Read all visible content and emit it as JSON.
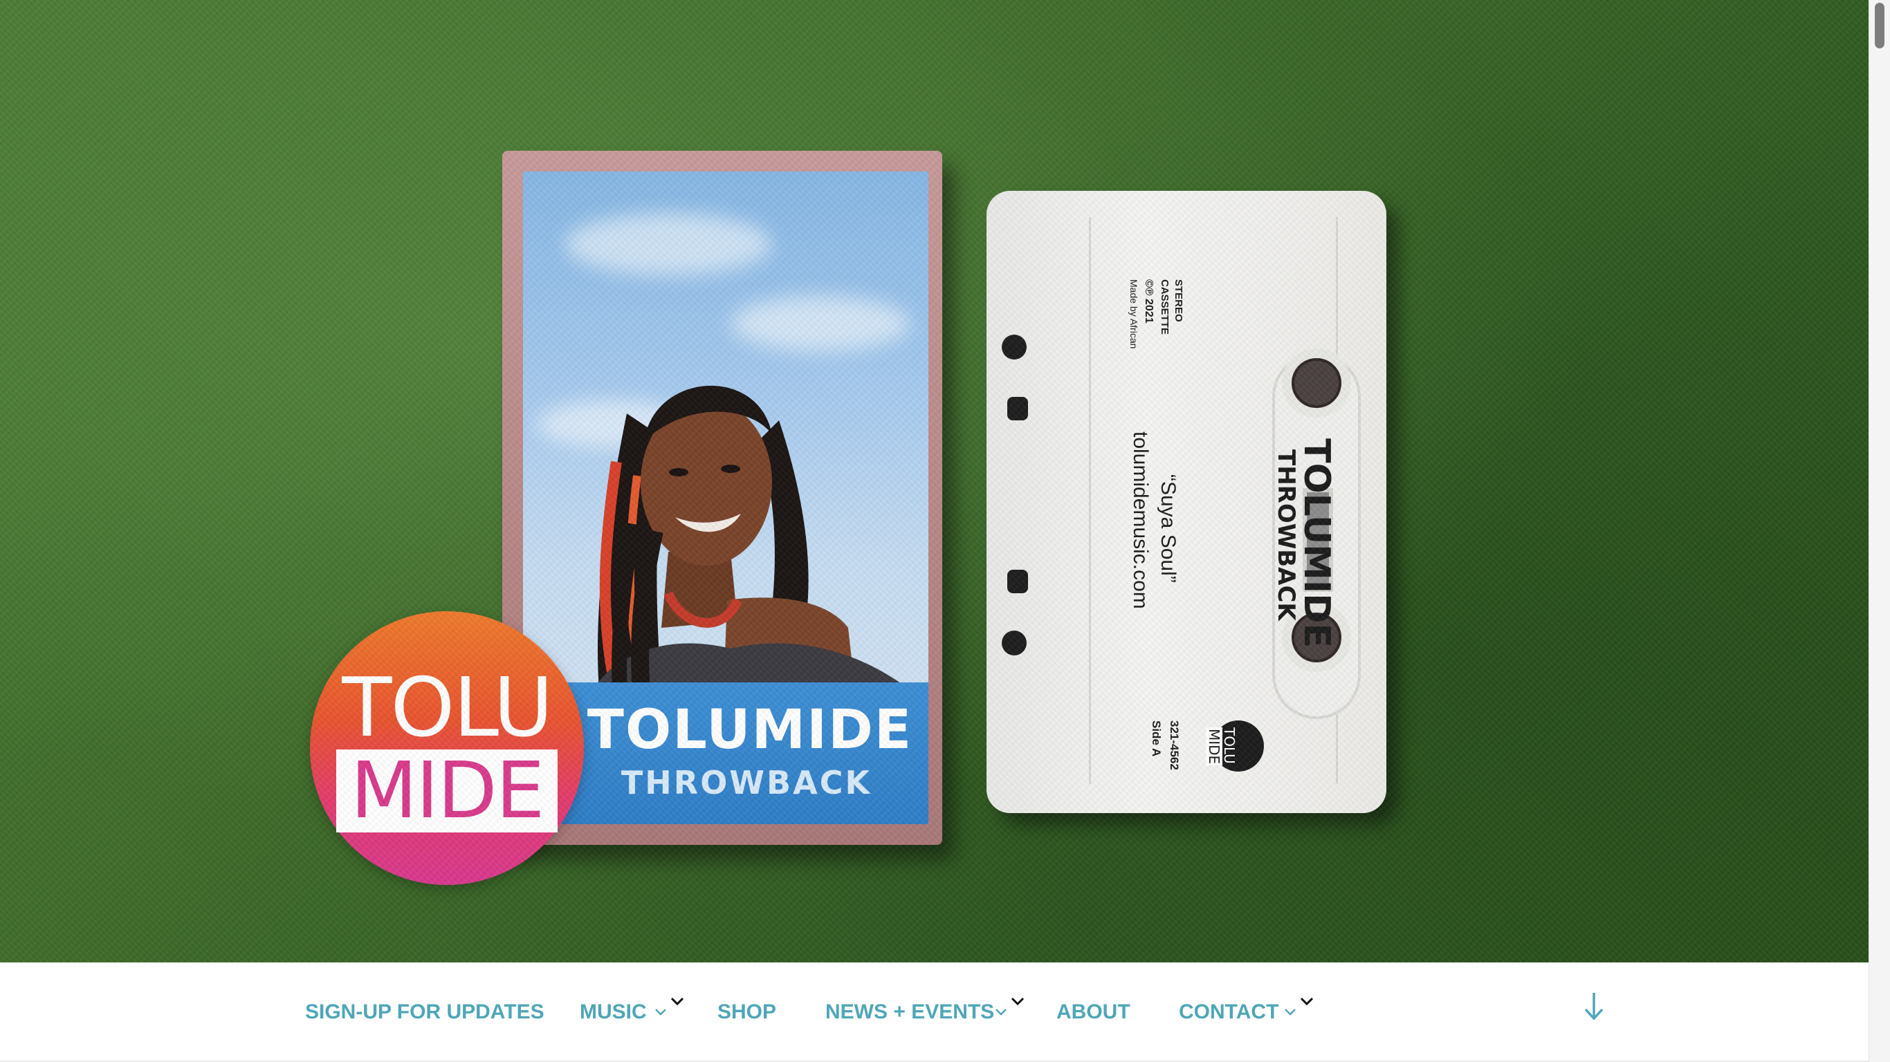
{
  "hero": {
    "case": {
      "title": "TOLUMIDE",
      "subtitle": "THROWBACK"
    },
    "tape": {
      "brand_title": "TOLUMIDE",
      "brand_subtitle": "THROWBACK",
      "song": "“Suya Soul”",
      "website": "tolumidemusic.com",
      "stereo_line1": "STEREO",
      "stereo_line2": "CASSETTE",
      "copyright": "©℗ 2021",
      "made_by": "Made by African",
      "catalog": "321-4562",
      "side": "Side A",
      "mini_logo_top": "TOLU",
      "mini_logo_bottom": "MIDE"
    },
    "logo": {
      "top": "TOLU",
      "bottom": "MIDE"
    }
  },
  "nav": {
    "items": [
      {
        "label": "SIGN-UP FOR UPDATES",
        "has_submenu": false
      },
      {
        "label": "MUSIC",
        "has_submenu": true
      },
      {
        "label": "SHOP",
        "has_submenu": false
      },
      {
        "label": "NEWS + EVENTS",
        "has_submenu": true
      },
      {
        "label": "ABOUT",
        "has_submenu": false
      },
      {
        "label": "CONTACT",
        "has_submenu": true
      }
    ],
    "scroll_down_icon": "arrow-down-icon",
    "submenu_icon": "chevron-down-icon",
    "color": "#4fa6b8"
  },
  "colors": {
    "background_green": "#3e6b2a",
    "accent_teal": "#4fa6b8",
    "logo_orange": "#ee7a2c",
    "logo_pink": "#d8388f"
  }
}
